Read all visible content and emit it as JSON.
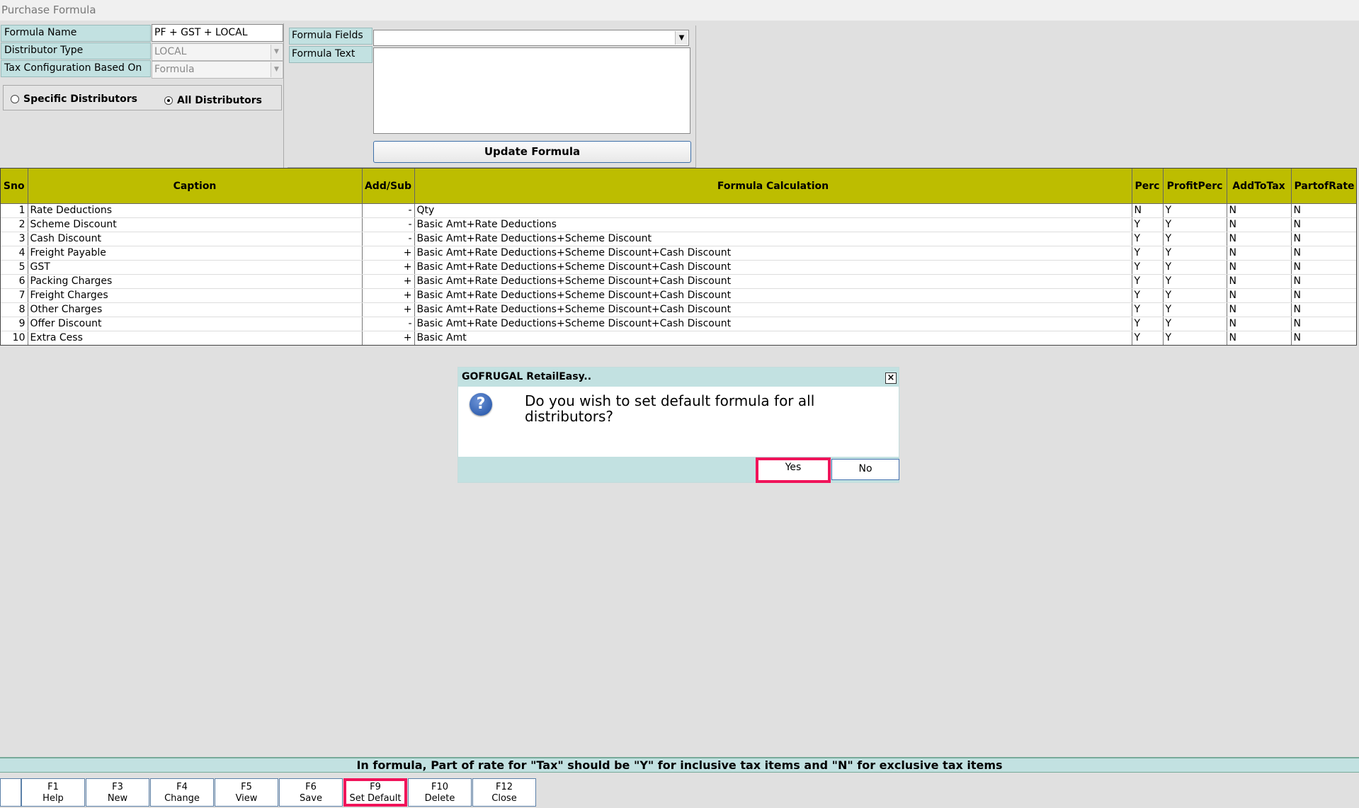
{
  "window": {
    "title": "Purchase Formula"
  },
  "form": {
    "formula_name_label": "Formula Name",
    "formula_name_value": "PF + GST + LOCAL",
    "distributor_type_label": "Distributor Type",
    "distributor_type_value": "LOCAL",
    "tax_config_label": "Tax Configuration Based On",
    "tax_config_value": "Formula",
    "radio_specific": "Specific Distributors",
    "radio_all": "All Distributors",
    "radio_selected": "All Distributors"
  },
  "formula": {
    "fields_label": "Formula Fields",
    "fields_value": "",
    "text_label": "Formula Text",
    "text_value": "",
    "update_button": "Update Formula"
  },
  "grid": {
    "headers": [
      "Sno",
      "Caption",
      "Add/Sub",
      "Formula Calculation",
      "Perc",
      "ProfitPerc",
      "AddToTax",
      "PartofRate"
    ],
    "rows": [
      {
        "sno": "1",
        "caption": "Rate Deductions",
        "addsub": "-",
        "calc": "Qty",
        "perc": "N",
        "profit": "Y",
        "addtax": "N",
        "partrate": "N"
      },
      {
        "sno": "2",
        "caption": "Scheme Discount",
        "addsub": "-",
        "calc": "Basic Amt+Rate Deductions",
        "perc": "Y",
        "profit": "Y",
        "addtax": "N",
        "partrate": "N"
      },
      {
        "sno": "3",
        "caption": "Cash Discount",
        "addsub": "-",
        "calc": "Basic Amt+Rate Deductions+Scheme Discount",
        "perc": "Y",
        "profit": "Y",
        "addtax": "N",
        "partrate": "N"
      },
      {
        "sno": "4",
        "caption": "Freight Payable",
        "addsub": "+",
        "calc": "Basic Amt+Rate Deductions+Scheme Discount+Cash Discount",
        "perc": "Y",
        "profit": "Y",
        "addtax": "N",
        "partrate": "N"
      },
      {
        "sno": "5",
        "caption": "GST",
        "addsub": "+",
        "calc": "Basic Amt+Rate Deductions+Scheme Discount+Cash Discount",
        "perc": "Y",
        "profit": "Y",
        "addtax": "N",
        "partrate": "N"
      },
      {
        "sno": "6",
        "caption": "Packing Charges",
        "addsub": "+",
        "calc": "Basic Amt+Rate Deductions+Scheme Discount+Cash Discount",
        "perc": "Y",
        "profit": "Y",
        "addtax": "N",
        "partrate": "N"
      },
      {
        "sno": "7",
        "caption": "Freight Charges",
        "addsub": "+",
        "calc": "Basic Amt+Rate Deductions+Scheme Discount+Cash Discount",
        "perc": "Y",
        "profit": "Y",
        "addtax": "N",
        "partrate": "N"
      },
      {
        "sno": "8",
        "caption": "Other Charges",
        "addsub": "+",
        "calc": "Basic Amt+Rate Deductions+Scheme Discount+Cash Discount",
        "perc": "Y",
        "profit": "Y",
        "addtax": "N",
        "partrate": "N"
      },
      {
        "sno": "9",
        "caption": "Offer Discount",
        "addsub": "-",
        "calc": "Basic Amt+Rate Deductions+Scheme Discount+Cash Discount",
        "perc": "Y",
        "profit": "Y",
        "addtax": "N",
        "partrate": "N"
      },
      {
        "sno": "10",
        "caption": "Extra Cess",
        "addsub": "+",
        "calc": "Basic Amt",
        "perc": "Y",
        "profit": "Y",
        "addtax": "N",
        "partrate": "N"
      }
    ]
  },
  "dialog": {
    "title": "GOFRUGAL RetailEasy..",
    "message": "Do you wish to set default formula for all distributors?",
    "yes": "Yes",
    "no": "No",
    "icon": "question-icon",
    "close_icon": "close-icon"
  },
  "hint": "In formula, Part of rate for \"Tax\" should be \"Y\" for inclusive tax items and \"N\" for exclusive tax items",
  "function_keys": [
    {
      "key": "F1",
      "label": "Help"
    },
    {
      "key": "F3",
      "label": "New"
    },
    {
      "key": "F4",
      "label": "Change"
    },
    {
      "key": "F5",
      "label": "View"
    },
    {
      "key": "F6",
      "label": "Save"
    },
    {
      "key": "F9",
      "label": "Set Default"
    },
    {
      "key": "F10",
      "label": "Delete"
    },
    {
      "key": "F12",
      "label": "Close"
    }
  ],
  "colors": {
    "label_bg": "#c2e1e1",
    "grid_header": "#bdbd00",
    "highlight": "#f0145a"
  }
}
